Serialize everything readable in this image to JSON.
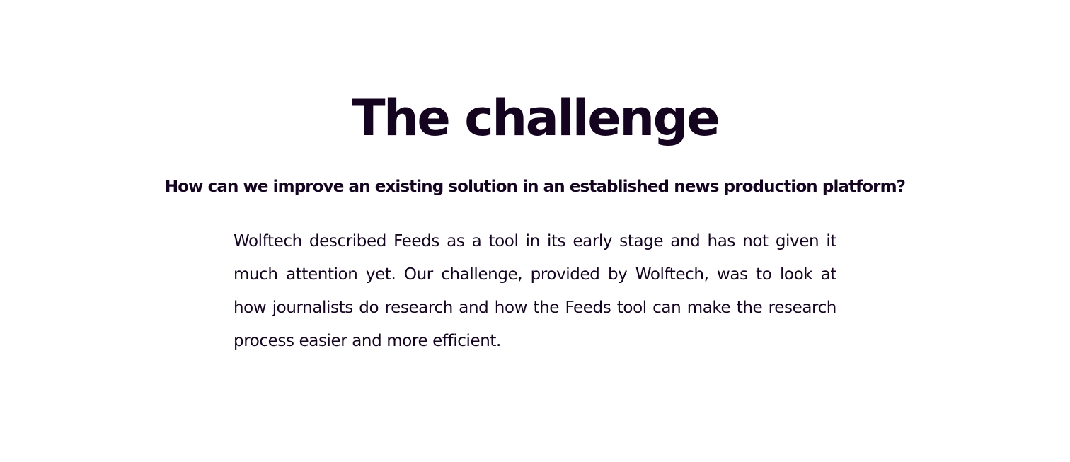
{
  "section": {
    "title": "The challenge",
    "subtitle": "How can we improve an existing solution in an established news production platform?",
    "body": "Wolftech described Feeds as a tool in its early stage and has not given it much attention yet. Our challenge, provided by Wolftech, was to look at how journalists do research and how the Feeds tool can make the research process easier and more efficient."
  },
  "colors": {
    "text": "#14041f",
    "background": "#ffffff"
  }
}
